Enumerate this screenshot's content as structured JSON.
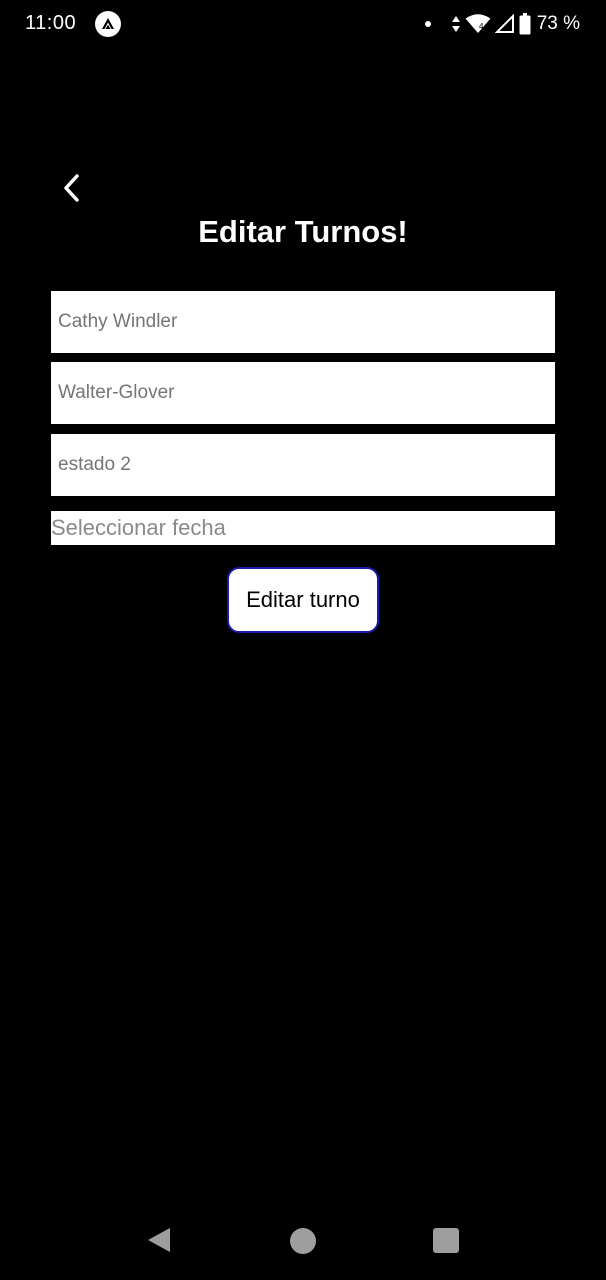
{
  "status_bar": {
    "time": "11:00",
    "battery": "73 %",
    "icons": [
      "app-badge-icon",
      "notification-dot-icon",
      "data-arrows-icon",
      "wifi-icon",
      "signal-icon",
      "battery-icon"
    ]
  },
  "header": {
    "back_icon": "chevron-left-icon",
    "title": "Editar Turnos!"
  },
  "form": {
    "field_1": {
      "value": "",
      "placeholder": "Cathy Windler"
    },
    "field_2": {
      "value": "",
      "placeholder": "Walter-Glover"
    },
    "field_3": {
      "value": "",
      "placeholder": "estado 2"
    },
    "date": {
      "label": "Seleccionar fecha"
    },
    "submit_label": "Editar turno"
  },
  "colors": {
    "background": "#000000",
    "field_background": "#ffffff",
    "placeholder": "#8a8a8a",
    "button_border": "#1a1ab0",
    "nav_icons": "#9e9e9e"
  },
  "nav_bar": {
    "icons": [
      "nav-back-icon",
      "nav-home-icon",
      "nav-recents-icon"
    ]
  }
}
